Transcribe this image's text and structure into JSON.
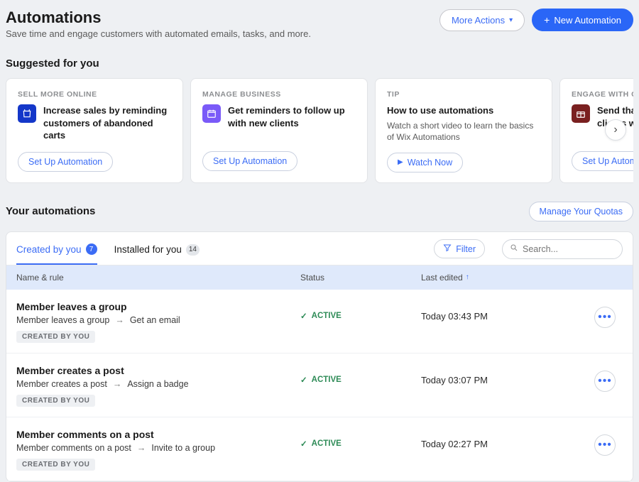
{
  "header": {
    "title": "Automations",
    "subtitle": "Save time and engage customers with automated emails, tasks, and more.",
    "more_actions": "More Actions",
    "new_automation": "New Automation"
  },
  "suggested": {
    "title": "Suggested for you",
    "cards": [
      {
        "eyebrow": "SELL MORE ONLINE",
        "text": "Increase sales by reminding customers of abandoned carts",
        "cta": "Set Up Automation",
        "icon": "bag"
      },
      {
        "eyebrow": "MANAGE BUSINESS",
        "text": "Get reminders to follow up with new clients",
        "cta": "Set Up Automation",
        "icon": "calendar"
      },
      {
        "eyebrow": "TIP",
        "title": "How to use automations",
        "desc": "Watch a short video to learn the basics of Wix Automations",
        "cta": "Watch Now",
        "icon": "play"
      },
      {
        "eyebrow": "ENGAGE WITH CLIENTS",
        "text": "Send thank you emails to clients who submit a form",
        "cta": "Set Up Automation",
        "icon": "gift"
      }
    ]
  },
  "your": {
    "title": "Your automations",
    "manage": "Manage Your Quotas"
  },
  "tabs": {
    "created": "Created by you",
    "created_count": "7",
    "installed": "Installed for you",
    "installed_count": "14",
    "filter": "Filter",
    "search_placeholder": "Search..."
  },
  "table": {
    "col_name": "Name & rule",
    "col_status": "Status",
    "col_edited": "Last edited"
  },
  "rows": [
    {
      "title": "Member leaves a group",
      "trigger": "Member leaves a group",
      "action": "Get an email",
      "tag": "CREATED BY YOU",
      "status": "ACTIVE",
      "edited": "Today 03:43 PM"
    },
    {
      "title": "Member creates a post",
      "trigger": "Member creates a post",
      "action": "Assign a badge",
      "tag": "CREATED BY YOU",
      "status": "ACTIVE",
      "edited": "Today 03:07 PM"
    },
    {
      "title": "Member comments on a post",
      "trigger": "Member comments on a post",
      "action": "Invite to a group",
      "tag": "CREATED BY YOU",
      "status": "ACTIVE",
      "edited": "Today 02:27 PM"
    }
  ]
}
